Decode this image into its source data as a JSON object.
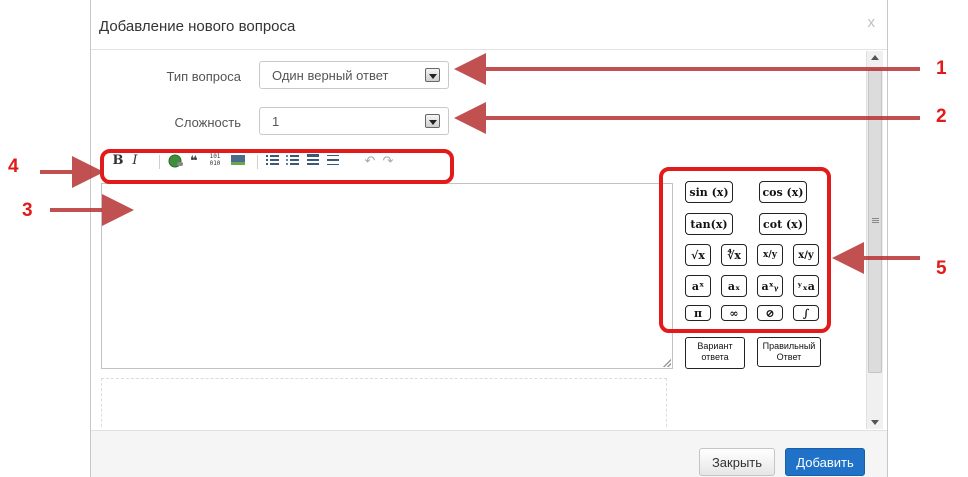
{
  "dialog": {
    "title": "Добавление нового вопроса",
    "close_icon": "close-icon",
    "close_glyph": "x"
  },
  "form": {
    "question_type": {
      "label": "Тип вопроса",
      "value": "Один верный ответ"
    },
    "difficulty": {
      "label": "Сложность",
      "value": "1"
    }
  },
  "toolbar": {
    "bold": "B",
    "italic": "I",
    "quote": "❝",
    "code": "101\n010",
    "undo": "↶",
    "redo": "↷"
  },
  "math_panel": {
    "functions": [
      "sin (x)",
      "cos (x)",
      "tan(x)",
      "cot (x)"
    ],
    "row3": [
      "√x",
      "∜x",
      "x/y",
      "x/y"
    ],
    "row4": [
      "aˣ",
      "aₓ",
      "aˣᵧ",
      "ʸₓa"
    ],
    "row5": [
      "π",
      "∞",
      "⊘",
      "∫"
    ],
    "answer_option": "Вариант ответа",
    "correct_answer": "Правильный Ответ"
  },
  "footer": {
    "close_label": "Закрыть",
    "add_label": "Добавить"
  },
  "annotations": {
    "labels": [
      "1",
      "2",
      "3",
      "4",
      "5"
    ],
    "color": "#e21a1a"
  },
  "colors": {
    "primary_button": "#1f72c7",
    "highlight": "#e21a1a"
  }
}
